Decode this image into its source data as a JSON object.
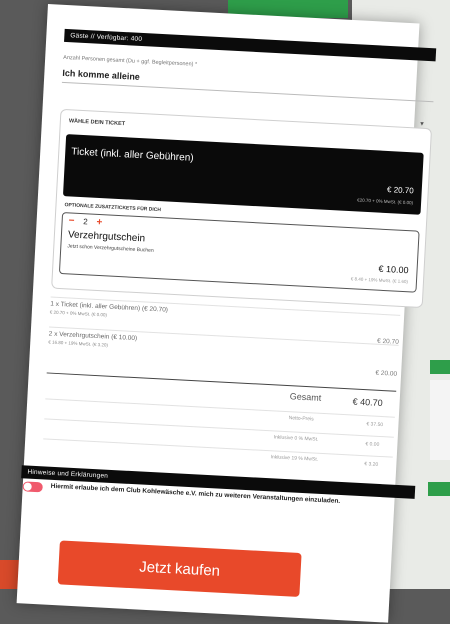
{
  "guests_header": "Gäste // Verfügbar: 400",
  "persons": {
    "label": "Anzahl Personen gesamt (Du + ggf. Begleitpersonen) *",
    "value": "Ich komme alleine"
  },
  "ticket_section": {
    "heading": "WÄHLE DEIN TICKET",
    "ticket": {
      "name": "Ticket (inkl. aller Gebühren)",
      "price": "€ 20.70",
      "tax_note": "€20.70 + 0% MwSt. (€ 0.00)"
    },
    "extras_heading": "OPTIONALE ZUSATZTICKETS FÜR DICH",
    "extra": {
      "minus": "−",
      "quantity": "2",
      "plus": "+",
      "name": "Verzehrgutschein",
      "subtitle": "Jetzt schon Verzehrgutscheine Buchen",
      "price": "€ 10.00",
      "tax_note": "€ 8.40 + 19% MwSt. (€ 1.60)"
    }
  },
  "summary": {
    "lines": [
      {
        "title": "1 x Ticket (inkl. aller Gebühren) (€ 20.70)",
        "sub": "€ 20.70 + 0% MwSt. (€ 0.00)",
        "amount": "€ 20.70"
      },
      {
        "title": "2 x Verzehrgutschein (€ 10.00)",
        "sub": "€ 16.80 + 19% MwSt. (€ 3.20)",
        "amount": "€ 20.00"
      }
    ],
    "total_label": "Gesamt",
    "total_value": "€ 40.70",
    "breakdown": [
      {
        "label": "Netto-Preis",
        "value": "€ 37.50"
      },
      {
        "label": "Inklusive 0 % MwSt.",
        "value": "€ 0.00"
      },
      {
        "label": "Inklusive 19 % MwSt.",
        "value": "€ 3.20"
      }
    ]
  },
  "notes_header": "Hinweise und Erklärungen",
  "consent_text": "Hiermit erlaube ich dem Club Kohlewäsche e.V. mich zu weiteren Veranstaltungen einzuladen.",
  "buy_button": "Jetzt kaufen",
  "colors": {
    "accent": "#e8492a",
    "toggle": "#f05a6d",
    "bar": "#0b0b0b",
    "green": "#2e9e4a"
  }
}
